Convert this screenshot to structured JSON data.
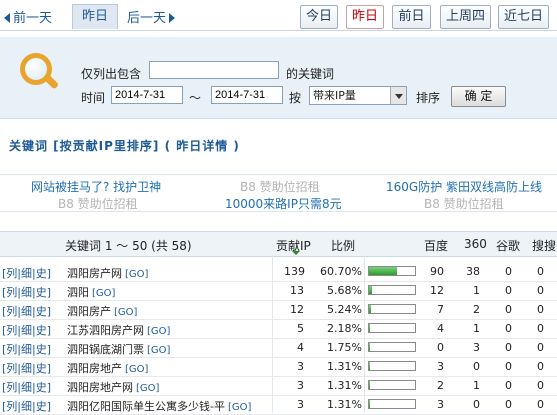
{
  "nav": {
    "prev_label": "前一天",
    "current_label": "昨日",
    "next_label": "后一天",
    "tabs": [
      {
        "label": "今日",
        "active": false
      },
      {
        "label": "昨日",
        "active": true
      },
      {
        "label": "前日",
        "active": false
      },
      {
        "label": "上周四",
        "active": false
      },
      {
        "label": "近七日",
        "active": false
      }
    ]
  },
  "filter": {
    "include_label": "仅列出包含",
    "keyword_suffix": "的关键词",
    "keyword_value": "",
    "time_label": "时间",
    "date_from": "2014-7-31",
    "tilde": "～",
    "date_to": "2014-7-31",
    "by_label": "按",
    "sort_select_value": "带来IP量",
    "sort_label": "排序",
    "confirm_button": "确 定"
  },
  "heading": "关键词 [按贡献IP里排序] ( 昨日详情 )",
  "ads": {
    "row1": [
      {
        "text": "网站被挂马了? 找护卫神",
        "kind": "link"
      },
      {
        "text": "B8 赞助位招租",
        "kind": "gray"
      },
      {
        "text": "160G防护 紫田双线高防上线",
        "kind": "link"
      }
    ],
    "row2": [
      {
        "text": "B8 赞助位招租",
        "kind": "gray"
      },
      {
        "text": "10000来路IP只需8元",
        "kind": "link"
      },
      {
        "text": "B8 赞助位招租",
        "kind": "gray"
      }
    ]
  },
  "table": {
    "headers": {
      "keyword": "关键词 1 ～ 50 (共 58)",
      "ip": "贡献IP",
      "ratio": "比例",
      "baidu": "百度",
      "s360": "360",
      "google": "谷歌",
      "sogou": "搜搜"
    },
    "action_links": [
      "列",
      "细",
      "史"
    ],
    "go_label": "[GO]",
    "rows": [
      {
        "keyword": "泗阳房产网",
        "ip": "139",
        "ratio": "60.70%",
        "fill": 0.607,
        "baidu": "90",
        "s360": "38",
        "google": "0",
        "sogou": "0"
      },
      {
        "keyword": "泗阳",
        "ip": "13",
        "ratio": "5.68%",
        "fill": 0.0568,
        "baidu": "12",
        "s360": "1",
        "google": "0",
        "sogou": "0"
      },
      {
        "keyword": "泗阳房产",
        "ip": "12",
        "ratio": "5.24%",
        "fill": 0.0524,
        "baidu": "7",
        "s360": "2",
        "google": "0",
        "sogou": "0"
      },
      {
        "keyword": "江苏泗阳房产网",
        "ip": "5",
        "ratio": "2.18%",
        "fill": 0.0218,
        "baidu": "4",
        "s360": "1",
        "google": "0",
        "sogou": "0"
      },
      {
        "keyword": "泗阳锅底湖门票",
        "ip": "4",
        "ratio": "1.75%",
        "fill": 0.0175,
        "baidu": "0",
        "s360": "3",
        "google": "0",
        "sogou": "0"
      },
      {
        "keyword": "泗阳房地产",
        "ip": "3",
        "ratio": "1.31%",
        "fill": 0.0131,
        "baidu": "3",
        "s360": "0",
        "google": "0",
        "sogou": "0"
      },
      {
        "keyword": "泗阳房地产网",
        "ip": "3",
        "ratio": "1.31%",
        "fill": 0.0131,
        "baidu": "2",
        "s360": "1",
        "google": "0",
        "sogou": "0"
      },
      {
        "keyword": "泗阳亿阳国际单生公寓多少钱-平",
        "ip": "3",
        "ratio": "1.31%",
        "fill": 0.0131,
        "baidu": "3",
        "s360": "0",
        "google": "0",
        "sogou": "0"
      }
    ]
  }
}
